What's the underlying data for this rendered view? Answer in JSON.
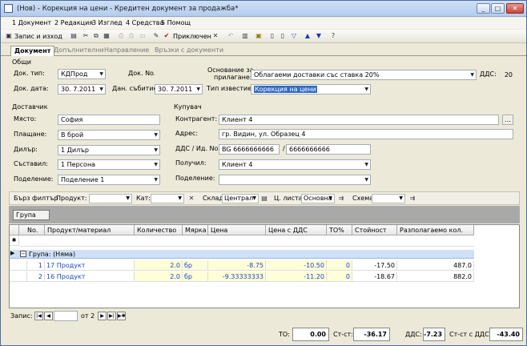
{
  "window": {
    "title": "(Нов) - Корекция на цени - Кредитен документ за продажба*"
  },
  "menu": [
    "1 Документ",
    "2 Редакция",
    "3 Изглед",
    "4 Средства",
    "5 Помощ"
  ],
  "toolbar": {
    "save_close": "Запис и изход",
    "post": "Приключен"
  },
  "tabs": [
    "Документ",
    "Допълнителни",
    "Направление",
    "Връзки с документи"
  ],
  "general": {
    "section": "Общи",
    "doc_type_label": "Док. тип:",
    "doc_type": "КДПрод",
    "doc_no_label": "Док. No.",
    "doc_no": "",
    "doc_date_label": "Док. дата:",
    "doc_date": "30. 7.2011",
    "event_date_label": "Дан. събитие:",
    "event_date": "30. 7.2011",
    "basis_label_1": "Основание за",
    "basis_label_2": "прилагане:",
    "basis": "Облагаеми доставки със ставка 20%",
    "vat_label": "ДДС:",
    "vat": "20",
    "notice_type_label": "Тип известие:",
    "notice_type": "Корекция на цени"
  },
  "supplier": {
    "section": "Доставчик",
    "place_label": "Място:",
    "place": "София",
    "payment_label": "Плащане:",
    "payment": "В брой",
    "dealer_label": "Дилър:",
    "dealer": "1 Дилър",
    "author_label": "Съставил:",
    "author": "1 Персона",
    "division_label": "Поделение:",
    "division": "Поделение 1"
  },
  "buyer": {
    "section": "Купувач",
    "partner_label": "Контрагент:",
    "partner": "Клиент 4",
    "address_label": "Адрес:",
    "address": "гр. Видин, ул. Образец 4",
    "vat_id_label": "ДДС / Ид. No.",
    "vat_no": "BG 6666666666",
    "slash": "/",
    "id_no": "6666666666",
    "receiver_label": "Получил:",
    "receiver": "Клиент 4",
    "division_label": "Поделение:",
    "division": ""
  },
  "filter": {
    "quick_filter": "Бърз филтър",
    "product": "Продукт:",
    "category": "Кат:",
    "warehouse_label": "Склад",
    "warehouse": "Централ",
    "price_list_label": "Ц. листа",
    "price_list": "Основна",
    "scheme_label": "Схема"
  },
  "grouping": {
    "chip": "Група"
  },
  "grid": {
    "columns": [
      "No.",
      "Продукт/материал",
      "Количество",
      "Мярка",
      "Цена",
      "Цена с ДДС",
      "ТО%",
      "Стойност",
      "Разполагаемо кол."
    ],
    "group_row": "Група: (Няма)",
    "rows": [
      {
        "no": "1",
        "product": "17 Продукт",
        "qty": "2.0",
        "unit": "бр",
        "price": "-8.75",
        "price_vat": "-10.50",
        "to": "0",
        "value": "-17.50",
        "avail": "487.0"
      },
      {
        "no": "2",
        "product": "16 Продукт",
        "qty": "2.0",
        "unit": "бр",
        "price": "-9.33333333",
        "price_vat": "-11.20",
        "to": "0",
        "value": "-18.67",
        "avail": "882.0"
      }
    ]
  },
  "pager": {
    "label": "Запис:",
    "of": "от 2"
  },
  "totals": {
    "to_label": "ТО:",
    "to": "0.00",
    "cost_label": "Ст-ст:",
    "cost": "-36.17",
    "vat_label": "ДДС:",
    "vat": "-7.23",
    "total_label": "Ст-ст с ДДС:",
    "total": "-43.40"
  }
}
